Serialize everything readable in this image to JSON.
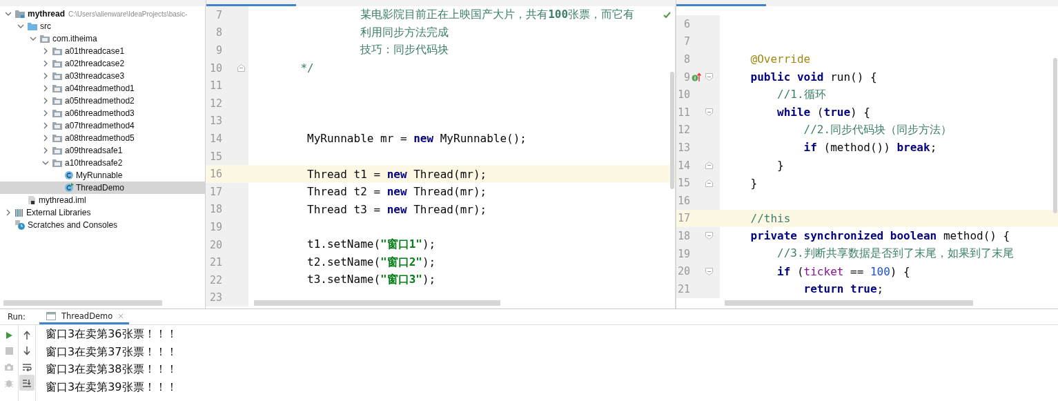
{
  "project_tree": [
    {
      "label": "mythread",
      "path": "C:\\Users\\alienware\\IdeaProjects\\basic-",
      "kind": "module",
      "expanded": true,
      "selected": false,
      "children": [
        {
          "label": "src",
          "kind": "source",
          "expanded": true,
          "selected": false,
          "children": [
            {
              "label": "com.itheima",
              "kind": "package",
              "expanded": true,
              "selected": false,
              "children": [
                {
                  "label": "a01threadcase1",
                  "kind": "package",
                  "expanded": false,
                  "selected": false
                },
                {
                  "label": "a02threadcase2",
                  "kind": "package",
                  "expanded": false,
                  "selected": false
                },
                {
                  "label": "a03threadcase3",
                  "kind": "package",
                  "expanded": false,
                  "selected": false
                },
                {
                  "label": "a04threadmethod1",
                  "kind": "package",
                  "expanded": false,
                  "selected": false
                },
                {
                  "label": "a05threadmethod2",
                  "kind": "package",
                  "expanded": false,
                  "selected": false
                },
                {
                  "label": "a06threadmethod3",
                  "kind": "package",
                  "expanded": false,
                  "selected": false
                },
                {
                  "label": "a07threadmethod4",
                  "kind": "package",
                  "expanded": false,
                  "selected": false
                },
                {
                  "label": "a08threadmethod5",
                  "kind": "package",
                  "expanded": false,
                  "selected": false
                },
                {
                  "label": "a09threadsafe1",
                  "kind": "package",
                  "expanded": false,
                  "selected": false
                },
                {
                  "label": "a10threadsafe2",
                  "kind": "package",
                  "expanded": true,
                  "selected": false,
                  "children": [
                    {
                      "label": "MyRunnable",
                      "kind": "class",
                      "selected": false
                    },
                    {
                      "label": "ThreadDemo",
                      "kind": "runnable-class",
                      "selected": true
                    }
                  ]
                }
              ]
            }
          ]
        },
        {
          "label": "mythread.iml",
          "kind": "iml",
          "selected": false
        }
      ]
    },
    {
      "label": "External Libraries",
      "kind": "library",
      "expanded": false,
      "selected": false
    },
    {
      "label": "Scratches and Consoles",
      "kind": "scratches",
      "selected": false
    }
  ],
  "editors": [
    {
      "lines": [
        {
          "number": "7",
          "highlighted": false,
          "fold_start": false,
          "fold_end": false,
          "implements_marker": false,
          "tokens": [
            {
              "text": "                某电影院目前正在上映国产大片，共有",
              "kind": "comment"
            },
            {
              "text": "100",
              "kind": "comment-bold"
            },
            {
              "text": "张票，而它有",
              "kind": "comment"
            }
          ]
        },
        {
          "number": "8",
          "highlighted": false,
          "fold_start": false,
          "fold_end": false,
          "implements_marker": false,
          "tokens": [
            {
              "text": "                利用同步方法完成",
              "kind": "comment"
            }
          ]
        },
        {
          "number": "9",
          "highlighted": false,
          "fold_start": false,
          "fold_end": false,
          "implements_marker": false,
          "tokens": [
            {
              "text": "                技巧：同步代码块",
              "kind": "comment"
            }
          ]
        },
        {
          "number": "10",
          "highlighted": false,
          "fold_start": false,
          "fold_end": true,
          "implements_marker": false,
          "tokens": [
            {
              "text": "       */",
              "kind": "comment"
            }
          ]
        },
        {
          "number": "11",
          "highlighted": false,
          "fold_start": false,
          "fold_end": false,
          "implements_marker": false
        },
        {
          "number": "12",
          "highlighted": false,
          "fold_start": false,
          "fold_end": false,
          "implements_marker": false
        },
        {
          "number": "13",
          "highlighted": false,
          "fold_start": false,
          "fold_end": false,
          "implements_marker": false
        },
        {
          "number": "14",
          "highlighted": false,
          "fold_start": false,
          "fold_end": false,
          "implements_marker": false,
          "tokens": [
            {
              "text": "        MyRunnable mr = ",
              "kind": "plain"
            },
            {
              "text": "new",
              "kind": "keyword"
            },
            {
              "text": " MyRunnable();",
              "kind": "plain"
            }
          ]
        },
        {
          "number": "15",
          "highlighted": false,
          "fold_start": false,
          "fold_end": false,
          "implements_marker": false
        },
        {
          "number": "16",
          "highlighted": true,
          "fold_start": false,
          "fold_end": false,
          "implements_marker": false,
          "tokens": [
            {
              "text": "        Thread t1 = ",
              "kind": "plain"
            },
            {
              "text": "new",
              "kind": "keyword"
            },
            {
              "text": " Thread(mr);",
              "kind": "plain"
            }
          ]
        },
        {
          "number": "17",
          "highlighted": false,
          "fold_start": false,
          "fold_end": false,
          "implements_marker": false,
          "tokens": [
            {
              "text": "        Thread t2 = ",
              "kind": "plain"
            },
            {
              "text": "new",
              "kind": "keyword"
            },
            {
              "text": " Thread(mr);",
              "kind": "plain"
            }
          ]
        },
        {
          "number": "18",
          "highlighted": false,
          "fold_start": false,
          "fold_end": false,
          "implements_marker": false,
          "tokens": [
            {
              "text": "        Thread t3 = ",
              "kind": "plain"
            },
            {
              "text": "new",
              "kind": "keyword"
            },
            {
              "text": " Thread(mr);",
              "kind": "plain"
            }
          ]
        },
        {
          "number": "19",
          "highlighted": false,
          "fold_start": false,
          "fold_end": false,
          "implements_marker": false
        },
        {
          "number": "20",
          "highlighted": false,
          "fold_start": false,
          "fold_end": false,
          "implements_marker": false,
          "tokens": [
            {
              "text": "        t1.setName(",
              "kind": "plain"
            },
            {
              "text": "\"窗口1\"",
              "kind": "string"
            },
            {
              "text": ");",
              "kind": "plain"
            }
          ]
        },
        {
          "number": "21",
          "highlighted": false,
          "fold_start": false,
          "fold_end": false,
          "implements_marker": false,
          "tokens": [
            {
              "text": "        t2.setName(",
              "kind": "plain"
            },
            {
              "text": "\"窗口2\"",
              "kind": "string"
            },
            {
              "text": ");",
              "kind": "plain"
            }
          ]
        },
        {
          "number": "22",
          "highlighted": false,
          "fold_start": false,
          "fold_end": false,
          "implements_marker": false,
          "tokens": [
            {
              "text": "        t3.setName(",
              "kind": "plain"
            },
            {
              "text": "\"窗口3\"",
              "kind": "string"
            },
            {
              "text": ");",
              "kind": "plain"
            }
          ]
        },
        {
          "number": "23",
          "highlighted": false,
          "fold_start": false,
          "fold_end": false,
          "implements_marker": false
        }
      ]
    },
    {
      "lines": [
        {
          "number": "6",
          "highlighted": false,
          "fold_start": false,
          "fold_end": false,
          "implements_marker": false
        },
        {
          "number": "7",
          "highlighted": false,
          "fold_start": false,
          "fold_end": false,
          "implements_marker": false
        },
        {
          "number": "8",
          "highlighted": false,
          "fold_start": false,
          "fold_end": false,
          "implements_marker": false,
          "tokens": [
            {
              "text": "    @Override",
              "kind": "annotation"
            }
          ]
        },
        {
          "number": "9",
          "highlighted": false,
          "fold_start": true,
          "fold_end": false,
          "implements_marker": true,
          "tokens": [
            {
              "text": "    public void",
              "kind": "keyword"
            },
            {
              "text": " run() {",
              "kind": "plain"
            }
          ]
        },
        {
          "number": "10",
          "highlighted": false,
          "fold_start": false,
          "fold_end": false,
          "implements_marker": false,
          "tokens": [
            {
              "text": "        //1.循环",
              "kind": "comment"
            }
          ]
        },
        {
          "number": "11",
          "highlighted": false,
          "fold_start": true,
          "fold_end": false,
          "implements_marker": false,
          "tokens": [
            {
              "text": "        while",
              "kind": "keyword"
            },
            {
              "text": " (",
              "kind": "plain"
            },
            {
              "text": "true",
              "kind": "keyword"
            },
            {
              "text": ") {",
              "kind": "plain"
            }
          ]
        },
        {
          "number": "12",
          "highlighted": false,
          "fold_start": false,
          "fold_end": false,
          "implements_marker": false,
          "tokens": [
            {
              "text": "            //2.同步代码块（同步方法）",
              "kind": "comment"
            }
          ]
        },
        {
          "number": "13",
          "highlighted": false,
          "fold_start": false,
          "fold_end": false,
          "implements_marker": false,
          "tokens": [
            {
              "text": "            if",
              "kind": "keyword"
            },
            {
              "text": " (method()) ",
              "kind": "plain"
            },
            {
              "text": "break",
              "kind": "keyword"
            },
            {
              "text": ";",
              "kind": "plain"
            }
          ]
        },
        {
          "number": "14",
          "highlighted": false,
          "fold_start": false,
          "fold_end": true,
          "implements_marker": false,
          "tokens": [
            {
              "text": "        }",
              "kind": "plain"
            }
          ]
        },
        {
          "number": "15",
          "highlighted": false,
          "fold_start": false,
          "fold_end": true,
          "implements_marker": false,
          "tokens": [
            {
              "text": "    }",
              "kind": "plain"
            }
          ]
        },
        {
          "number": "16",
          "highlighted": false,
          "fold_start": false,
          "fold_end": false,
          "implements_marker": false
        },
        {
          "number": "17",
          "highlighted": true,
          "fold_start": false,
          "fold_end": false,
          "implements_marker": false,
          "tokens": [
            {
              "text": "    //this",
              "kind": "comment"
            }
          ]
        },
        {
          "number": "18",
          "highlighted": false,
          "fold_start": true,
          "fold_end": false,
          "implements_marker": false,
          "tokens": [
            {
              "text": "    private synchronized boolean",
              "kind": "keyword"
            },
            {
              "text": " method() {",
              "kind": "plain"
            }
          ]
        },
        {
          "number": "19",
          "highlighted": false,
          "fold_start": false,
          "fold_end": false,
          "implements_marker": false,
          "tokens": [
            {
              "text": "        //3.判断共享数据是否到了末尾，如果到了末尾",
              "kind": "comment"
            }
          ]
        },
        {
          "number": "20",
          "highlighted": false,
          "fold_start": true,
          "fold_end": false,
          "implements_marker": false,
          "tokens": [
            {
              "text": "        if",
              "kind": "keyword"
            },
            {
              "text": " (",
              "kind": "plain"
            },
            {
              "text": "ticket",
              "kind": "field"
            },
            {
              "text": " == ",
              "kind": "plain"
            },
            {
              "text": "100",
              "kind": "number"
            },
            {
              "text": ") {",
              "kind": "plain"
            }
          ]
        },
        {
          "number": "21",
          "highlighted": false,
          "fold_start": false,
          "fold_end": false,
          "implements_marker": false,
          "tokens": [
            {
              "text": "            return true",
              "kind": "keyword"
            },
            {
              "text": ";",
              "kind": "plain"
            }
          ]
        }
      ]
    }
  ],
  "run_panel": {
    "label": "Run:",
    "tabs": [
      {
        "label": "ThreadDemo",
        "selected": true
      }
    ],
    "tools_left": [
      {
        "kind": "run"
      },
      {
        "kind": "stop"
      },
      {
        "kind": "camera"
      },
      {
        "kind": "debug"
      }
    ],
    "tools_right": [
      {
        "kind": "up",
        "selected": false
      },
      {
        "kind": "down",
        "selected": false
      },
      {
        "kind": "wrap",
        "selected": false
      },
      {
        "kind": "scroll-end",
        "selected": true
      }
    ],
    "output": [
      "窗口3在卖第36张票！！！",
      "窗口3在卖第37张票！！！",
      "窗口3在卖第38张票！！！",
      "窗口3在卖第39张票！！！"
    ]
  }
}
